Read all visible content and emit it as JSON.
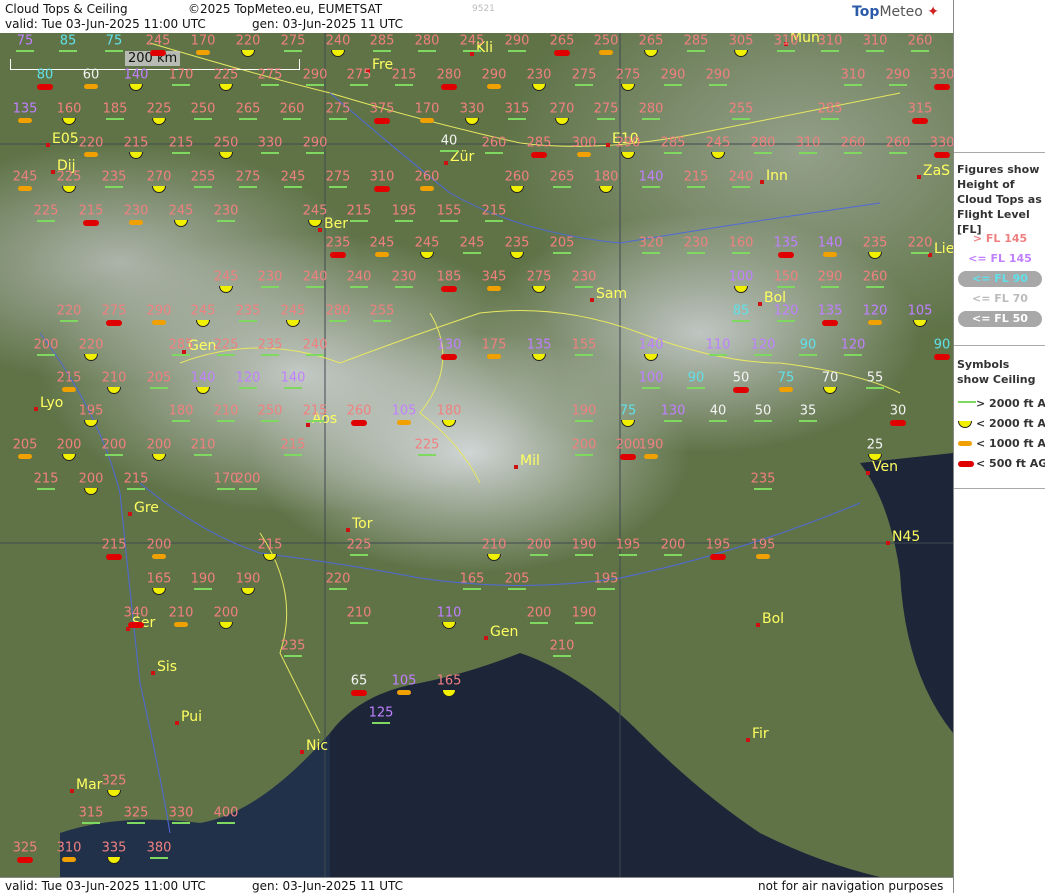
{
  "header": {
    "title": "Cloud Tops & Ceiling",
    "copyright": "©2025 TopMeteo.eu, EUMETSAT",
    "valid": "valid:  Tue  03-Jun-2025  11:00 UTC",
    "gen": "gen: 03-Jun-2025 11 UTC",
    "code": "9521",
    "logo_main": "Top",
    "logo_sub": "Meteo"
  },
  "footer": {
    "valid": "valid:  Tue  03-Jun-2025  11:00 UTC",
    "gen": "gen: 03-Jun-2025 11 UTC",
    "note": "not for air navigation purposes"
  },
  "scale_label": "200 km",
  "legend": {
    "figures_title": "Figures show Height of Cloud Tops as Flight Level  [FL]",
    "fl_items": [
      {
        "label": "> FL 145",
        "color": "#f08080",
        "pill": false
      },
      {
        "label": "<= FL 145",
        "color": "#c080ff",
        "pill": false
      },
      {
        "label": "<= FL 90",
        "color": "#60e0e8",
        "pill": true
      },
      {
        "label": "<= FL 70",
        "color": "#f4f4f4",
        "pill": false,
        "grey": true
      },
      {
        "label": "<= FL 50",
        "color": "#ffffff",
        "pill": true
      }
    ],
    "symbols_title": "Symbols show Ceiling",
    "sym_items": [
      {
        "label": "> 2000 ft AGL",
        "symbol": "green-line"
      },
      {
        "label": "< 2000 ft AGL",
        "symbol": "yellow-cup"
      },
      {
        "label": "< 1000 ft AGL",
        "symbol": "orange-bar"
      },
      {
        "label": "< 500 ft AGL",
        "symbol": "red-bar"
      }
    ]
  },
  "cities": [
    {
      "name": "Fre"
    },
    {
      "name": "Kli"
    },
    {
      "name": "Mun"
    },
    {
      "name": "Zür"
    },
    {
      "name": "Dij"
    },
    {
      "name": "Inn"
    },
    {
      "name": "ZaS"
    },
    {
      "name": "Ber"
    },
    {
      "name": "Lie"
    },
    {
      "name": "Sam"
    },
    {
      "name": "Bol"
    },
    {
      "name": "Gen"
    },
    {
      "name": "Lyo"
    },
    {
      "name": "Aos"
    },
    {
      "name": "Mil"
    },
    {
      "name": "Ven"
    },
    {
      "name": "Gre"
    },
    {
      "name": "Tor"
    },
    {
      "name": "N45"
    },
    {
      "name": "Ser"
    },
    {
      "name": "Bol"
    },
    {
      "name": "Gen"
    },
    {
      "name": "Sis"
    },
    {
      "name": "Pui"
    },
    {
      "name": "Nic"
    },
    {
      "name": "Fir"
    },
    {
      "name": "Mar"
    },
    {
      "name": "E05"
    },
    {
      "name": "E10"
    }
  ],
  "cloud_tops": [
    {
      "v": "75",
      "c": "v"
    },
    {
      "v": "85",
      "c": "c"
    },
    {
      "v": "75",
      "c": "c"
    },
    {
      "v": "245",
      "c": "p"
    },
    {
      "v": "170",
      "c": "p"
    },
    {
      "v": "220",
      "c": "p"
    },
    {
      "v": "275",
      "c": "p"
    },
    {
      "v": "240",
      "c": "p"
    },
    {
      "v": "285",
      "c": "p"
    },
    {
      "v": "280",
      "c": "p"
    },
    {
      "v": "245",
      "c": "p"
    },
    {
      "v": "290",
      "c": "p"
    },
    {
      "v": "265",
      "c": "p"
    },
    {
      "v": "250",
      "c": "p"
    },
    {
      "v": "265",
      "c": "p"
    },
    {
      "v": "285",
      "c": "p"
    },
    {
      "v": "305",
      "c": "p"
    },
    {
      "v": "310",
      "c": "p"
    },
    {
      "v": "310",
      "c": "p"
    },
    {
      "v": "310",
      "c": "p"
    },
    {
      "v": "260",
      "c": "p"
    },
    {
      "v": "80",
      "c": "c"
    },
    {
      "v": "60",
      "c": "w"
    },
    {
      "v": "140",
      "c": "v"
    },
    {
      "v": "170",
      "c": "p"
    },
    {
      "v": "225",
      "c": "p"
    },
    {
      "v": "275",
      "c": "p"
    },
    {
      "v": "290",
      "c": "p"
    },
    {
      "v": "275",
      "c": "p"
    },
    {
      "v": "215",
      "c": "p"
    },
    {
      "v": "280",
      "c": "p"
    },
    {
      "v": "290",
      "c": "p"
    },
    {
      "v": "230",
      "c": "p"
    },
    {
      "v": "275",
      "c": "p"
    },
    {
      "v": "275",
      "c": "p"
    },
    {
      "v": "290",
      "c": "p"
    },
    {
      "v": "290",
      "c": "p"
    },
    {
      "v": "310",
      "c": "p"
    },
    {
      "v": "290",
      "c": "p"
    },
    {
      "v": "330",
      "c": "p"
    },
    {
      "v": "135",
      "c": "v"
    },
    {
      "v": "160",
      "c": "p"
    },
    {
      "v": "185",
      "c": "p"
    },
    {
      "v": "225",
      "c": "p"
    },
    {
      "v": "250",
      "c": "p"
    },
    {
      "v": "265",
      "c": "p"
    },
    {
      "v": "260",
      "c": "p"
    },
    {
      "v": "275",
      "c": "p"
    },
    {
      "v": "375",
      "c": "p"
    },
    {
      "v": "170",
      "c": "p"
    },
    {
      "v": "330",
      "c": "p"
    },
    {
      "v": "315",
      "c": "p"
    },
    {
      "v": "270",
      "c": "p"
    },
    {
      "v": "275",
      "c": "p"
    },
    {
      "v": "280",
      "c": "p"
    },
    {
      "v": "255",
      "c": "p"
    },
    {
      "v": "285",
      "c": "p"
    },
    {
      "v": "315",
      "c": "p"
    },
    {
      "v": "220",
      "c": "p"
    },
    {
      "v": "215",
      "c": "p"
    },
    {
      "v": "215",
      "c": "p"
    },
    {
      "v": "250",
      "c": "p"
    },
    {
      "v": "330",
      "c": "p"
    },
    {
      "v": "290",
      "c": "p"
    },
    {
      "v": "40",
      "c": "w"
    },
    {
      "v": "260",
      "c": "p"
    },
    {
      "v": "285",
      "c": "p"
    },
    {
      "v": "300",
      "c": "p"
    },
    {
      "v": "290",
      "c": "p"
    },
    {
      "v": "285",
      "c": "p"
    },
    {
      "v": "245",
      "c": "p"
    },
    {
      "v": "280",
      "c": "p"
    },
    {
      "v": "310",
      "c": "p"
    },
    {
      "v": "260",
      "c": "p"
    },
    {
      "v": "260",
      "c": "p"
    },
    {
      "v": "330",
      "c": "p"
    },
    {
      "v": "245",
      "c": "p"
    },
    {
      "v": "225",
      "c": "p"
    },
    {
      "v": "235",
      "c": "p"
    },
    {
      "v": "270",
      "c": "p"
    },
    {
      "v": "255",
      "c": "p"
    },
    {
      "v": "275",
      "c": "p"
    },
    {
      "v": "245",
      "c": "p"
    },
    {
      "v": "275",
      "c": "p"
    },
    {
      "v": "310",
      "c": "p"
    },
    {
      "v": "260",
      "c": "p"
    },
    {
      "v": "260",
      "c": "p"
    },
    {
      "v": "265",
      "c": "p"
    },
    {
      "v": "180",
      "c": "p"
    },
    {
      "v": "140",
      "c": "v"
    },
    {
      "v": "215",
      "c": "p"
    },
    {
      "v": "240",
      "c": "p"
    },
    {
      "v": "225",
      "c": "p"
    },
    {
      "v": "215",
      "c": "p"
    },
    {
      "v": "230",
      "c": "p"
    },
    {
      "v": "245",
      "c": "p"
    },
    {
      "v": "230",
      "c": "p"
    },
    {
      "v": "245",
      "c": "p"
    },
    {
      "v": "215",
      "c": "p"
    },
    {
      "v": "195",
      "c": "p"
    },
    {
      "v": "155",
      "c": "p"
    },
    {
      "v": "215",
      "c": "p"
    },
    {
      "v": "235",
      "c": "p"
    },
    {
      "v": "245",
      "c": "p"
    },
    {
      "v": "245",
      "c": "p"
    },
    {
      "v": "245",
      "c": "p"
    },
    {
      "v": "235",
      "c": "p"
    },
    {
      "v": "205",
      "c": "p"
    },
    {
      "v": "320",
      "c": "p"
    },
    {
      "v": "230",
      "c": "p"
    },
    {
      "v": "160",
      "c": "p"
    },
    {
      "v": "135",
      "c": "v"
    },
    {
      "v": "140",
      "c": "v"
    },
    {
      "v": "235",
      "c": "p"
    },
    {
      "v": "220",
      "c": "p"
    },
    {
      "v": "245",
      "c": "p"
    },
    {
      "v": "230",
      "c": "p"
    },
    {
      "v": "240",
      "c": "p"
    },
    {
      "v": "240",
      "c": "p"
    },
    {
      "v": "230",
      "c": "p"
    },
    {
      "v": "185",
      "c": "p"
    },
    {
      "v": "345",
      "c": "p"
    },
    {
      "v": "275",
      "c": "p"
    },
    {
      "v": "230",
      "c": "p"
    },
    {
      "v": "100",
      "c": "v"
    },
    {
      "v": "150",
      "c": "p"
    },
    {
      "v": "290",
      "c": "p"
    },
    {
      "v": "260",
      "c": "p"
    },
    {
      "v": "220",
      "c": "p"
    },
    {
      "v": "275",
      "c": "p"
    },
    {
      "v": "290",
      "c": "p"
    },
    {
      "v": "245",
      "c": "p"
    },
    {
      "v": "235",
      "c": "p"
    },
    {
      "v": "245",
      "c": "p"
    },
    {
      "v": "280",
      "c": "p"
    },
    {
      "v": "255",
      "c": "p"
    },
    {
      "v": "85",
      "c": "c"
    },
    {
      "v": "120",
      "c": "v"
    },
    {
      "v": "135",
      "c": "v"
    },
    {
      "v": "120",
      "c": "v"
    },
    {
      "v": "105",
      "c": "v"
    },
    {
      "v": "200",
      "c": "p"
    },
    {
      "v": "220",
      "c": "p"
    },
    {
      "v": "285",
      "c": "p"
    },
    {
      "v": "225",
      "c": "p"
    },
    {
      "v": "235",
      "c": "p"
    },
    {
      "v": "240",
      "c": "p"
    },
    {
      "v": "130",
      "c": "v"
    },
    {
      "v": "175",
      "c": "p"
    },
    {
      "v": "135",
      "c": "v"
    },
    {
      "v": "155",
      "c": "p"
    },
    {
      "v": "140",
      "c": "v"
    },
    {
      "v": "110",
      "c": "v"
    },
    {
      "v": "120",
      "c": "v"
    },
    {
      "v": "90",
      "c": "c"
    },
    {
      "v": "120",
      "c": "v"
    },
    {
      "v": "90",
      "c": "c"
    },
    {
      "v": "215",
      "c": "p"
    },
    {
      "v": "210",
      "c": "p"
    },
    {
      "v": "205",
      "c": "p"
    },
    {
      "v": "140",
      "c": "v"
    },
    {
      "v": "120",
      "c": "v"
    },
    {
      "v": "140",
      "c": "v"
    },
    {
      "v": "100",
      "c": "v"
    },
    {
      "v": "90",
      "c": "c"
    },
    {
      "v": "50",
      "c": "w"
    },
    {
      "v": "75",
      "c": "c"
    },
    {
      "v": "70",
      "c": "w"
    },
    {
      "v": "55",
      "c": "w"
    },
    {
      "v": "195",
      "c": "p"
    },
    {
      "v": "180",
      "c": "p"
    },
    {
      "v": "210",
      "c": "p"
    },
    {
      "v": "250",
      "c": "p"
    },
    {
      "v": "215",
      "c": "p"
    },
    {
      "v": "260",
      "c": "p"
    },
    {
      "v": "105",
      "c": "v"
    },
    {
      "v": "180",
      "c": "p"
    },
    {
      "v": "190",
      "c": "p"
    },
    {
      "v": "75",
      "c": "c"
    },
    {
      "v": "130",
      "c": "v"
    },
    {
      "v": "40",
      "c": "w"
    },
    {
      "v": "50",
      "c": "w"
    },
    {
      "v": "35",
      "c": "w"
    },
    {
      "v": "30",
      "c": "w"
    },
    {
      "v": "205",
      "c": "p"
    },
    {
      "v": "200",
      "c": "p"
    },
    {
      "v": "200",
      "c": "p"
    },
    {
      "v": "200",
      "c": "p"
    },
    {
      "v": "210",
      "c": "p"
    },
    {
      "v": "215",
      "c": "p"
    },
    {
      "v": "225",
      "c": "p"
    },
    {
      "v": "200",
      "c": "p"
    },
    {
      "v": "200",
      "c": "p"
    },
    {
      "v": "190",
      "c": "p"
    },
    {
      "v": "25",
      "c": "w"
    },
    {
      "v": "215",
      "c": "p"
    },
    {
      "v": "200",
      "c": "p"
    },
    {
      "v": "215",
      "c": "p"
    },
    {
      "v": "170",
      "c": "p"
    },
    {
      "v": "200",
      "c": "p"
    },
    {
      "v": "235",
      "c": "p"
    },
    {
      "v": "215",
      "c": "p"
    },
    {
      "v": "200",
      "c": "p"
    },
    {
      "v": "215",
      "c": "p"
    },
    {
      "v": "225",
      "c": "p"
    },
    {
      "v": "210",
      "c": "p"
    },
    {
      "v": "200",
      "c": "p"
    },
    {
      "v": "190",
      "c": "p"
    },
    {
      "v": "195",
      "c": "p"
    },
    {
      "v": "200",
      "c": "p"
    },
    {
      "v": "195",
      "c": "p"
    },
    {
      "v": "195",
      "c": "p"
    },
    {
      "v": "165",
      "c": "p"
    },
    {
      "v": "190",
      "c": "p"
    },
    {
      "v": "190",
      "c": "p"
    },
    {
      "v": "220",
      "c": "p"
    },
    {
      "v": "165",
      "c": "p"
    },
    {
      "v": "205",
      "c": "p"
    },
    {
      "v": "195",
      "c": "p"
    },
    {
      "v": "340",
      "c": "p"
    },
    {
      "v": "210",
      "c": "p"
    },
    {
      "v": "200",
      "c": "p"
    },
    {
      "v": "210",
      "c": "p"
    },
    {
      "v": "110",
      "c": "v"
    },
    {
      "v": "200",
      "c": "p"
    },
    {
      "v": "190",
      "c": "p"
    },
    {
      "v": "235",
      "c": "p"
    },
    {
      "v": "210",
      "c": "p"
    },
    {
      "v": "65",
      "c": "w"
    },
    {
      "v": "105",
      "c": "v"
    },
    {
      "v": "165",
      "c": "p"
    },
    {
      "v": "125",
      "c": "v"
    },
    {
      "v": "325",
      "c": "p"
    },
    {
      "v": "315",
      "c": "p"
    },
    {
      "v": "325",
      "c": "p"
    },
    {
      "v": "330",
      "c": "p"
    },
    {
      "v": "400",
      "c": "p"
    },
    {
      "v": "325",
      "c": "p"
    },
    {
      "v": "310",
      "c": "p"
    },
    {
      "v": "335",
      "c": "p"
    },
    {
      "v": "380",
      "c": "p"
    }
  ]
}
